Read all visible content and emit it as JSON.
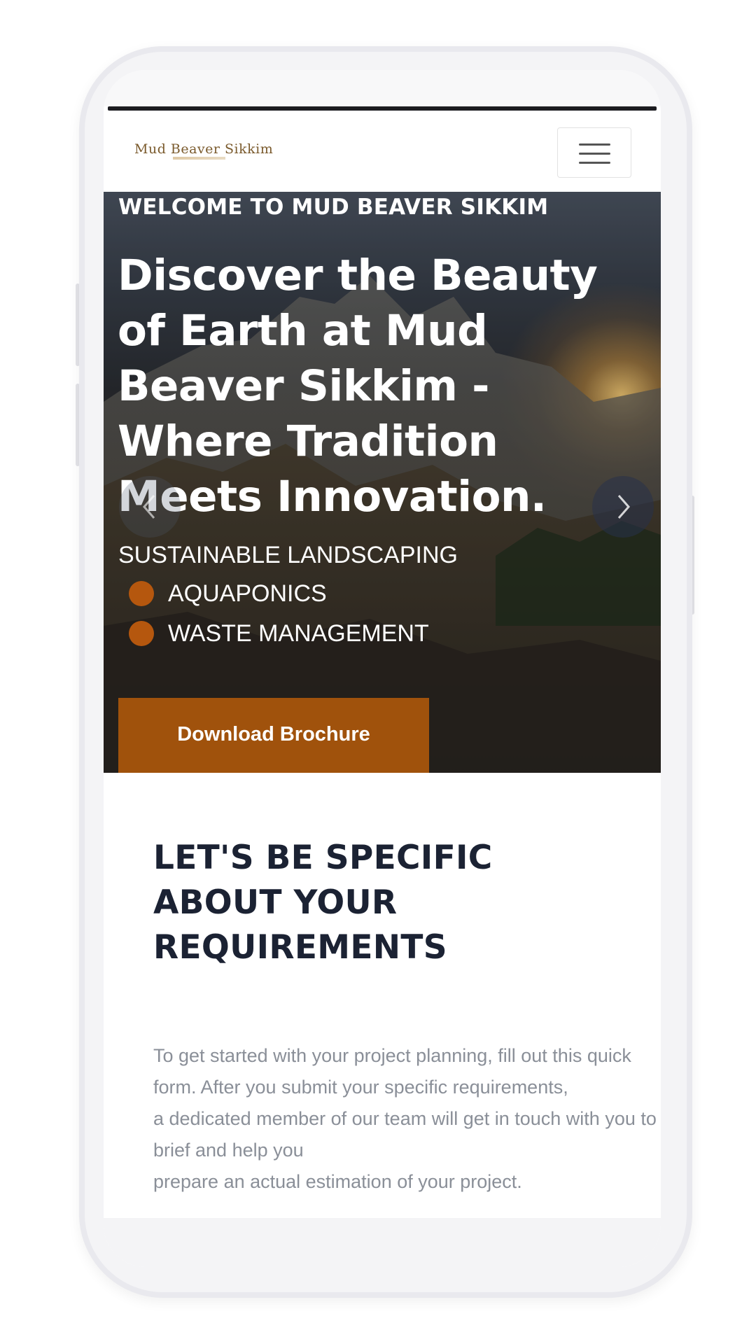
{
  "brand": {
    "logo_text": "Mud Beaver Sikkim"
  },
  "navbar": {
    "menu_icon": "hamburger-menu-icon"
  },
  "hero": {
    "welcome": "WELCOME TO MUD BEAVER SIKKIM",
    "headline": "Discover the Beauty of Earth at Mud Beaver Sikkim - Where Tradition Meets Innovation.",
    "services_title": "SUSTAINABLE LANDSCAPING",
    "services": [
      "AQUAPONICS",
      "WASTE MANAGEMENT"
    ],
    "download_label": "Download Brochure",
    "prev_icon": "chevron-left-icon",
    "next_icon": "chevron-right-icon"
  },
  "section": {
    "title": "LET'S BE SPECIFIC ABOUT YOUR REQUIREMENTS",
    "body": [
      "To get started with your project planning, fill out this quick form. After you submit your specific requirements,",
      "a dedicated member of our team will get in touch with you to brief and help you",
      "prepare an actual estimation of your project."
    ]
  },
  "colors": {
    "accent": "#a0520c",
    "bullet": "#b5570e",
    "heading": "#1b2233",
    "body_text": "#8a8f98"
  }
}
